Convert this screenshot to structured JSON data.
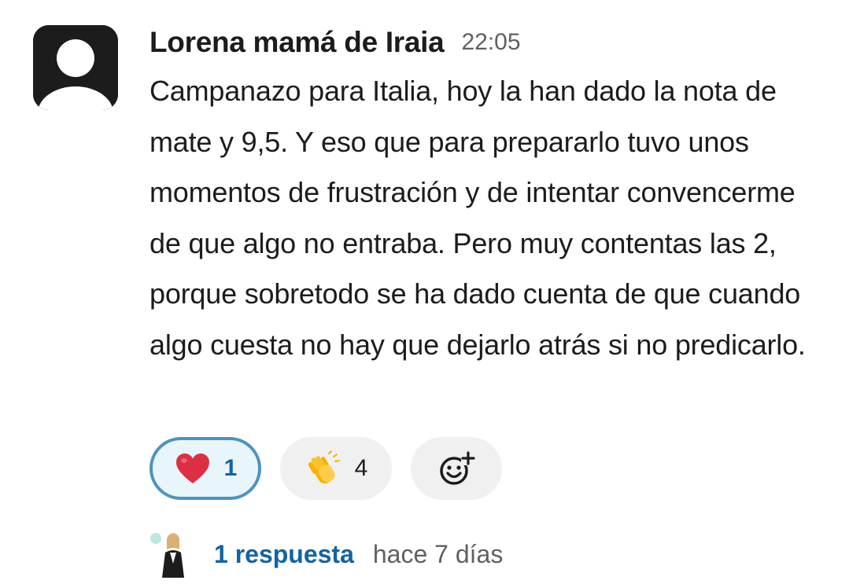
{
  "message": {
    "sender": "Lorena mamá de Iraia",
    "time": "22:05",
    "text": "Campanazo para Italia, hoy la han dado la nota de mate y 9,5. Y eso que para prepararlo tuvo unos momentos de frustración y de intentar convencerme de que algo no entraba. Pero muy contentas las 2, porque sobretodo se ha dado cuenta de que cuando algo cuesta no hay que dejarlo atrás si no predicarlo.",
    "avatar_icon": "default-user-avatar-icon"
  },
  "reactions": [
    {
      "emoji": "heart-icon",
      "count": "1",
      "active": true
    },
    {
      "emoji": "clapping-hands-icon",
      "count": "4",
      "active": false
    }
  ],
  "add_reaction_icon": "add-reaction-icon",
  "thread": {
    "replies": "1 respuesta",
    "last_reply": "hace 7 días"
  },
  "colors": {
    "text": "#1d1c1d",
    "muted": "#616061",
    "link": "#1264a3",
    "active_reaction_border": "#4b94be",
    "active_reaction_bg": "#e8f5fa",
    "reaction_bg": "#f0f0f0"
  }
}
